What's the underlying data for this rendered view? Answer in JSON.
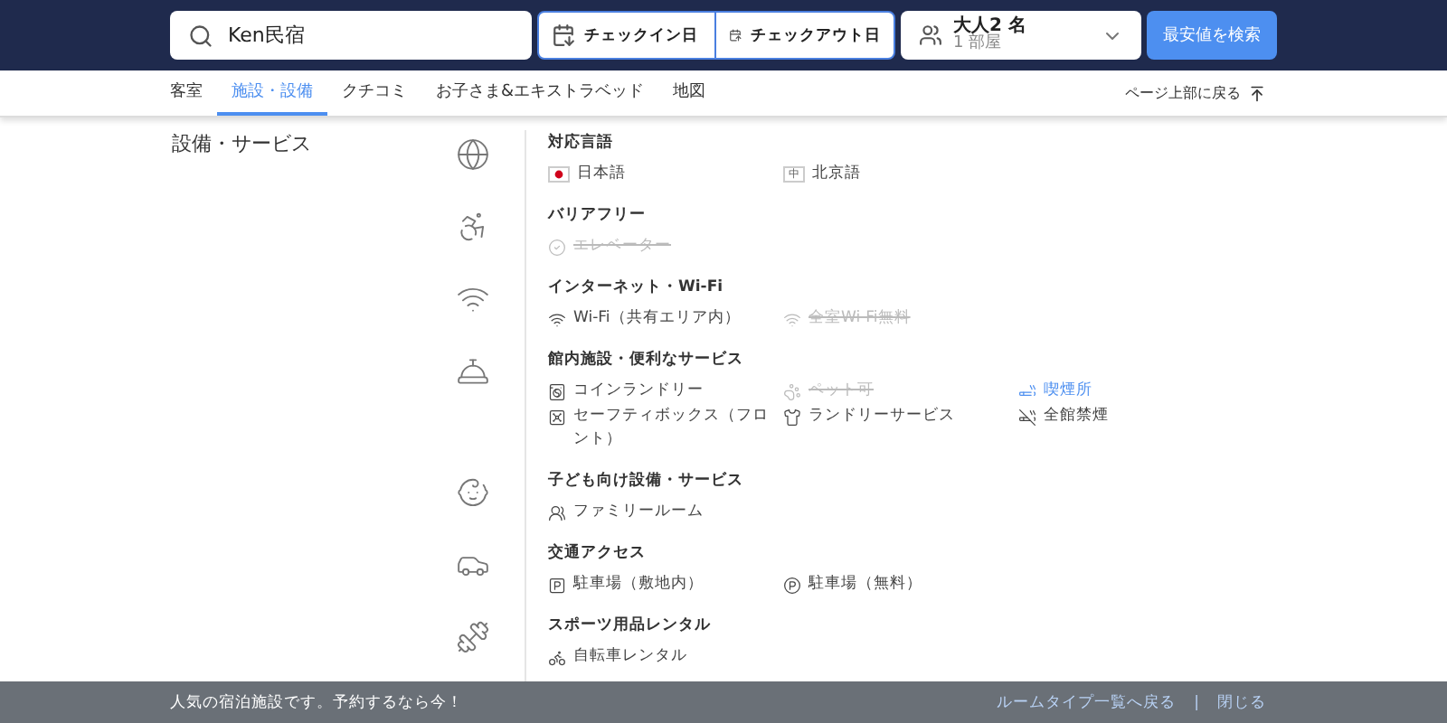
{
  "header": {
    "search_value": "Ken民宿",
    "checkin": "チェックイン日",
    "checkout": "チェックアウト日",
    "guests": "大人2 名",
    "rooms": "1 部屋",
    "search_button": "最安値を検索"
  },
  "nav": {
    "tabs": [
      {
        "label": "客室",
        "selected": false
      },
      {
        "label": "施設・設備",
        "selected": true
      },
      {
        "label": "クチコミ",
        "selected": false
      },
      {
        "label": "お子さま&エキストラベッド",
        "selected": false
      },
      {
        "label": "地図",
        "selected": false
      }
    ],
    "back_to_top": "ページ上部に戻る"
  },
  "page_title": "設備・サービス",
  "sections": [
    {
      "kind": "globe",
      "title": "対応言語",
      "items": [
        {
          "kind": "flag-jp",
          "label": "日本語",
          "available": true,
          "highlighted": false
        },
        {
          "kind": "flag-text",
          "flag_text": "中",
          "label": "北京語",
          "available": true,
          "highlighted": false
        }
      ]
    },
    {
      "kind": "accessible",
      "title": "バリアフリー",
      "items": [
        {
          "kind": "check",
          "label": "エレベーター",
          "available": false,
          "highlighted": false
        }
      ]
    },
    {
      "kind": "wifi",
      "title": "インターネット・Wi-Fi",
      "items": [
        {
          "kind": "wifi",
          "label": "Wi-Fi（共有エリア内）",
          "available": true,
          "highlighted": false
        },
        {
          "kind": "wifi",
          "label": "全室Wi-Fi無料",
          "available": false,
          "highlighted": false
        }
      ]
    },
    {
      "kind": "bell",
      "title": "館内施設・便利なサービス",
      "items": [
        {
          "kind": "washer",
          "label": "コインランドリー",
          "available": true,
          "highlighted": false
        },
        {
          "kind": "paw",
          "label": "ペット可",
          "available": false,
          "highlighted": false
        },
        {
          "kind": "smoking",
          "label": "喫煙所",
          "available": true,
          "highlighted": true
        },
        {
          "kind": "safe",
          "label": "セーフティボックス（フロント）",
          "available": true,
          "highlighted": false
        },
        {
          "kind": "laundry",
          "label": "ランドリーサービス",
          "available": true,
          "highlighted": false
        },
        {
          "kind": "nosmoking",
          "label": "全館禁煙",
          "available": true,
          "highlighted": false
        }
      ]
    },
    {
      "kind": "baby",
      "title": "子ども向け設備・サービス",
      "items": [
        {
          "kind": "family",
          "label": "ファミリールーム",
          "available": true,
          "highlighted": false
        }
      ]
    },
    {
      "kind": "car",
      "title": "交通アクセス",
      "items": [
        {
          "kind": "parking-lot",
          "label": "駐車場（敷地内）",
          "available": true,
          "highlighted": false
        },
        {
          "kind": "parking",
          "label": "駐車場（無料）",
          "available": true,
          "highlighted": false
        }
      ]
    },
    {
      "kind": "rental",
      "title": "スポーツ用品レンタル",
      "items": [
        {
          "kind": "bike",
          "label": "自転車レンタル",
          "available": true,
          "highlighted": false
        }
      ]
    }
  ],
  "footer": {
    "message": "人気の宿泊施設です。予約するなら今！",
    "links": [
      "ルームタイプ一覧へ戻る",
      "閉じる"
    ],
    "separator": "|"
  }
}
